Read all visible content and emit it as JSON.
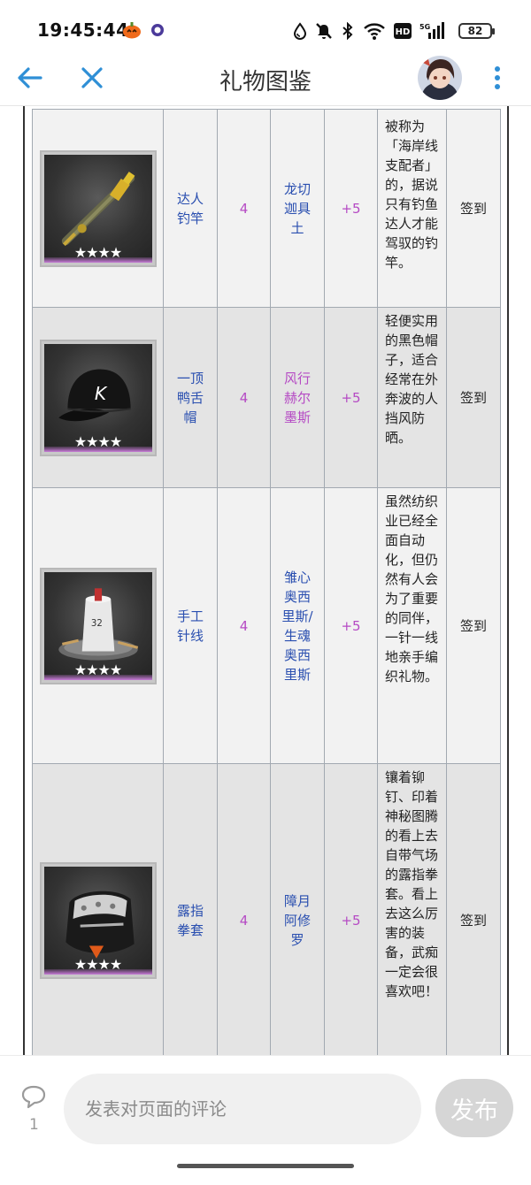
{
  "status_bar": {
    "time": "19:45:44",
    "battery": "82"
  },
  "header": {
    "title": "礼物图鉴"
  },
  "table": {
    "rows": [
      {
        "name": "达人钓竿",
        "stars": "4",
        "character": "龙切迦具土",
        "character_color": "blue",
        "favor": "+5",
        "description": "被称为「海岸线支配者」的，据说只有钓鱼达人才能驾驭的钓竿。",
        "source": "签到",
        "rating": "★★★★",
        "image": "fishing-rod"
      },
      {
        "name": "一顶鸭舌帽",
        "stars": "4",
        "character": "风行赫尔墨斯",
        "character_color": "purple",
        "favor": "+5",
        "description": "轻便实用的黑色帽子，适合经常在外奔波的人挡风防晒。",
        "source": "签到",
        "rating": "★★★★",
        "image": "baseball-cap"
      },
      {
        "name": "手工针线",
        "stars": "4",
        "character": "雏心奥西里斯/生魂奥西里斯",
        "character_color": "blue",
        "favor": "+5",
        "description": "虽然纺织业已经全面自动化，但仍然有人会为了重要的同伴，一针一线地亲手编织礼物。",
        "source": "签到",
        "rating": "★★★★",
        "image": "thread-spool"
      },
      {
        "name": "露指拳套",
        "stars": "4",
        "character": "障月阿修罗",
        "character_color": "blue",
        "favor": "+5",
        "description": "镶着铆钉、印着神秘图腾的看上去自带气场的露指拳套。看上去这么厉害的装备，武痴一定会很喜欢吧！",
        "source": "签到",
        "rating": "★★★★",
        "image": "fingerless-glove"
      }
    ]
  },
  "comment_bar": {
    "count": "1",
    "placeholder": "发表对页面的评论",
    "publish_label": "发布"
  },
  "colors": {
    "accent": "#2f8fd6",
    "link_blue": "#2a4fb0",
    "purple": "#b54ac4"
  }
}
